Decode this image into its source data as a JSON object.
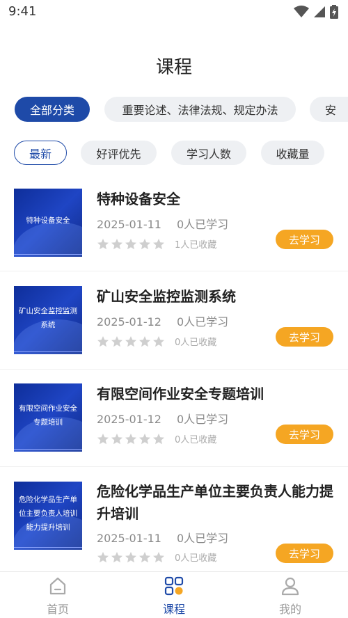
{
  "status_bar": {
    "time": "9:41"
  },
  "page_title": "课程",
  "categories": [
    {
      "label": "全部分类",
      "active": true
    },
    {
      "label": "重要论述、法律法规、规定办法",
      "active": false
    },
    {
      "label": "安",
      "active": false
    }
  ],
  "sort_options": [
    {
      "label": "最新",
      "active": true
    },
    {
      "label": "好评优先",
      "active": false
    },
    {
      "label": "学习人数",
      "active": false
    },
    {
      "label": "收藏量",
      "active": false
    }
  ],
  "courses": [
    {
      "thumb_text": "特种设备安全",
      "title": "特种设备安全",
      "date": "2025-01-11",
      "learners": "0人已学习",
      "rating": 0,
      "favorites": "1人已收藏",
      "action": "去学习"
    },
    {
      "thumb_text": "矿山安全监控监测系统",
      "title": "矿山安全监控监测系统",
      "date": "2025-01-12",
      "learners": "0人已学习",
      "rating": 0,
      "favorites": "0人已收藏",
      "action": "去学习"
    },
    {
      "thumb_text": "有限空间作业安全专题培训",
      "title": "有限空间作业安全专题培训",
      "date": "2025-01-12",
      "learners": "0人已学习",
      "rating": 0,
      "favorites": "0人已收藏",
      "action": "去学习"
    },
    {
      "thumb_text": "危险化学品生产单位主要负责人培训能力提升培训",
      "title": "危险化学品生产单位主要负责人能力提升培训",
      "date": "2025-01-11",
      "learners": "0人已学习",
      "rating": 0,
      "favorites": "0人已收藏",
      "action": "去学习"
    }
  ],
  "tabbar": [
    {
      "label": "首页",
      "icon": "home-icon",
      "active": false
    },
    {
      "label": "课程",
      "icon": "courses-grid-icon",
      "active": true
    },
    {
      "label": "我的",
      "icon": "profile-icon",
      "active": false
    }
  ],
  "colors": {
    "primary": "#1e4aa8",
    "accent": "#f5a623"
  }
}
